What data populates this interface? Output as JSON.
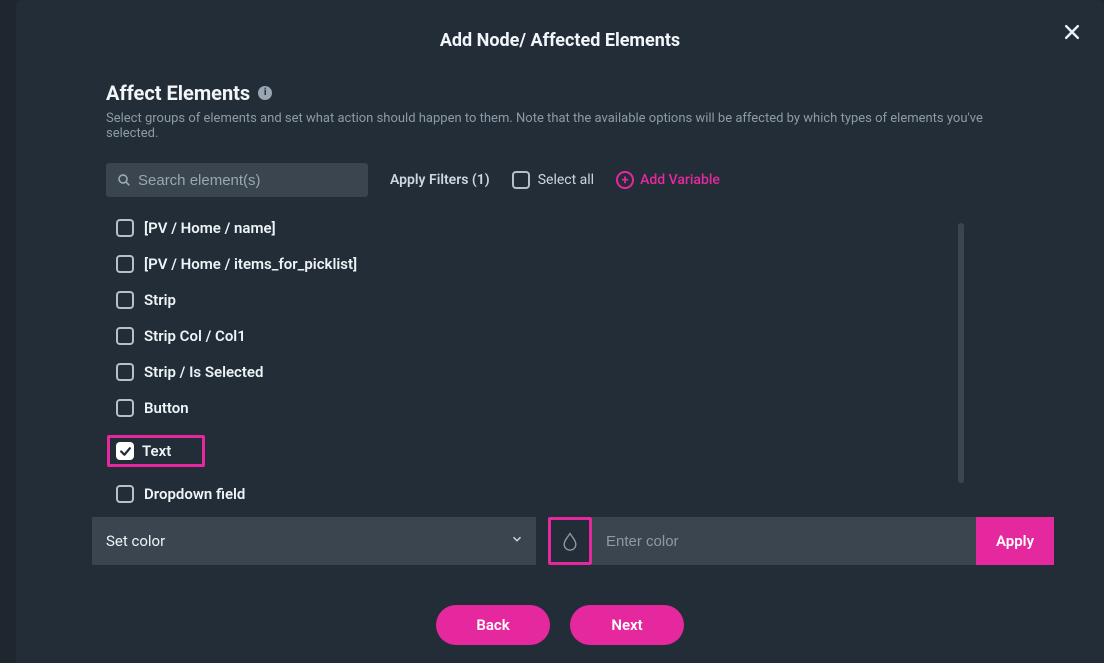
{
  "modal": {
    "title": "Add Node/ Affected Elements",
    "close_icon": "close"
  },
  "section": {
    "title": "Affect Elements",
    "info": "i",
    "description": "Select groups of elements and set what action should happen to them. Note that the available options will be affected by which types of elements you've selected."
  },
  "filters": {
    "search_placeholder": "Search element(s)",
    "apply_filters_label": "Apply Filters (1)",
    "select_all_label": "Select all",
    "add_variable_label": "Add Variable",
    "plus_icon": "+"
  },
  "elements": [
    {
      "label": "[PV / Home / name]",
      "checked": false,
      "highlight": false
    },
    {
      "label": "[PV / Home / items_for_picklist]",
      "checked": false,
      "highlight": false
    },
    {
      "label": "Strip",
      "checked": false,
      "highlight": false
    },
    {
      "label": "Strip Col / Col1",
      "checked": false,
      "highlight": false
    },
    {
      "label": "Strip / Is Selected",
      "checked": false,
      "highlight": false
    },
    {
      "label": "Button",
      "checked": false,
      "highlight": false
    },
    {
      "label": "Text",
      "checked": true,
      "highlight": true
    },
    {
      "label": "Dropdown field",
      "checked": false,
      "highlight": false
    }
  ],
  "action": {
    "select_label": "Set color",
    "color_value": "",
    "color_placeholder": "Enter color",
    "apply_label": "Apply"
  },
  "footer": {
    "back_label": "Back",
    "next_label": "Next"
  }
}
